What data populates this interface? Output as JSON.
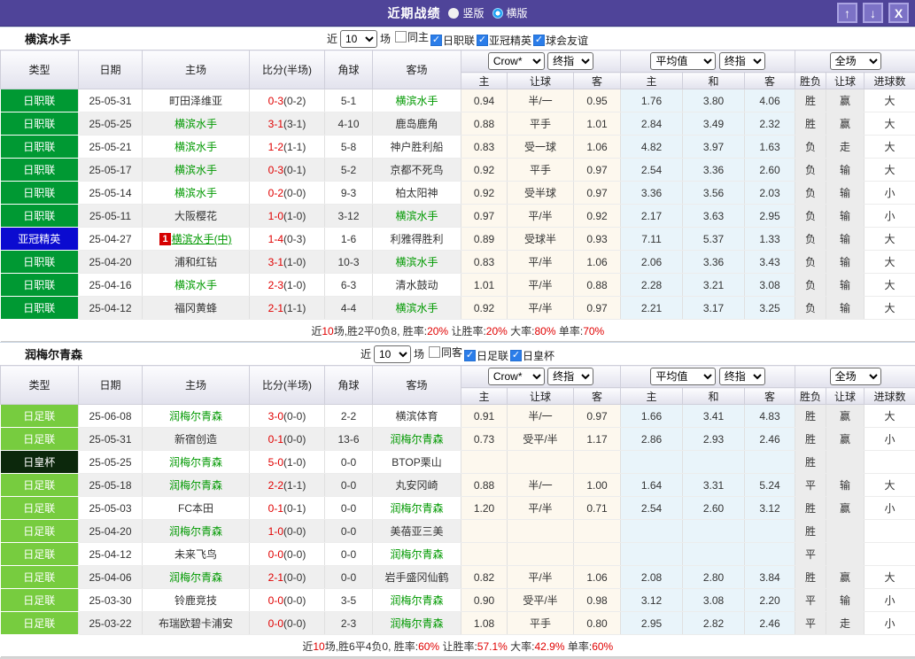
{
  "colors": {
    "titlebar_purple": "#4f4499",
    "button_purple": "#7c72c6",
    "checkbox_blue": "#2b7de9",
    "radio_selected_blue": "#1fa2f3",
    "jleague_green": "#009933",
    "acl_blue": "#0b0bd0",
    "jfl_light_green": "#77cc3f",
    "emperor_cup_dark": "#0c280c",
    "score_red": "#e00000",
    "self_team_green": "#009900",
    "lose_blue": "#2626cc",
    "crown_odds_bg": "#fdf8ee",
    "euro_odds_bg": "#e9f4fa",
    "result_col_bg": "#ececec"
  },
  "titlebar": {
    "title": "近期战绩",
    "radios": [
      {
        "label": "竖版",
        "selected": false
      },
      {
        "label": "横版",
        "selected": true
      }
    ],
    "up_icon": "↑",
    "down_icon": "↓",
    "close_icon": "X"
  },
  "filter_shared": {
    "near": "近",
    "games": "场"
  },
  "columns": {
    "type": "类型",
    "date": "日期",
    "home": "主场",
    "score": "比分(半场)",
    "corner": "角球",
    "away": "客场",
    "ah_home": "主",
    "ah_line": "让球",
    "ah_away": "客",
    "eu_home": "主",
    "eu_draw": "和",
    "eu_away": "客",
    "result": "胜负",
    "handicap_result": "让球",
    "goals": "进球数"
  },
  "sections": [
    {
      "team": "横滨水手",
      "selects": {
        "count": "10",
        "crown": "Crow*",
        "crown_final": "终指",
        "avg": "平均值",
        "avg_final": "终指",
        "full": "全场"
      },
      "filters": [
        {
          "label": "同主",
          "checked": false
        },
        {
          "label": "日职联",
          "checked": true
        },
        {
          "label": "亚冠精英",
          "checked": true
        },
        {
          "label": "球会友谊",
          "checked": true
        }
      ],
      "rows": [
        {
          "league": "日职联",
          "league_class": "jleague",
          "date": "25-05-31",
          "home": "町田泽维亚",
          "home_self": false,
          "score": "0-3",
          "half": "(0-2)",
          "corner": "5-1",
          "away": "横滨水手",
          "away_self": true,
          "ah": [
            "0.94",
            "半/一",
            "0.95"
          ],
          "eu": [
            "1.76",
            "3.80",
            "4.06"
          ],
          "res": [
            "胜",
            "赢",
            "大"
          ]
        },
        {
          "league": "日职联",
          "league_class": "jleague",
          "date": "25-05-25",
          "home": "横滨水手",
          "home_self": true,
          "score": "3-1",
          "half": "(3-1)",
          "corner": "4-10",
          "away": "鹿岛鹿角",
          "away_self": false,
          "ah": [
            "0.88",
            "平手",
            "1.01"
          ],
          "eu": [
            "2.84",
            "3.49",
            "2.32"
          ],
          "res": [
            "胜",
            "赢",
            "大"
          ]
        },
        {
          "league": "日职联",
          "league_class": "jleague",
          "date": "25-05-21",
          "home": "横滨水手",
          "home_self": true,
          "score": "1-2",
          "half": "(1-1)",
          "corner": "5-8",
          "away": "神户胜利船",
          "away_self": false,
          "ah": [
            "0.83",
            "受一球",
            "1.06"
          ],
          "eu": [
            "4.82",
            "3.97",
            "1.63"
          ],
          "res": [
            "负",
            "走",
            "大"
          ]
        },
        {
          "league": "日职联",
          "league_class": "jleague",
          "date": "25-05-17",
          "home": "横滨水手",
          "home_self": true,
          "score": "0-3",
          "half": "(0-1)",
          "corner": "5-2",
          "away": "京都不死鸟",
          "away_self": false,
          "ah": [
            "0.92",
            "平手",
            "0.97"
          ],
          "eu": [
            "2.54",
            "3.36",
            "2.60"
          ],
          "res": [
            "负",
            "输",
            "大"
          ]
        },
        {
          "league": "日职联",
          "league_class": "jleague",
          "date": "25-05-14",
          "home": "横滨水手",
          "home_self": true,
          "score": "0-2",
          "half": "(0-0)",
          "corner": "9-3",
          "away": "柏太阳神",
          "away_self": false,
          "ah": [
            "0.92",
            "受半球",
            "0.97"
          ],
          "eu": [
            "3.36",
            "3.56",
            "2.03"
          ],
          "res": [
            "负",
            "输",
            "小"
          ]
        },
        {
          "league": "日职联",
          "league_class": "jleague",
          "date": "25-05-11",
          "home": "大阪樱花",
          "home_self": false,
          "score": "1-0",
          "half": "(1-0)",
          "corner": "3-12",
          "away": "横滨水手",
          "away_self": true,
          "ah": [
            "0.97",
            "平/半",
            "0.92"
          ],
          "eu": [
            "2.17",
            "3.63",
            "2.95"
          ],
          "res": [
            "负",
            "输",
            "小"
          ]
        },
        {
          "league": "亚冠精英",
          "league_class": "acl",
          "date": "25-04-27",
          "home": "横滨水手(中)",
          "home_self": true,
          "home_underline": true,
          "badge": "1",
          "score": "1-4",
          "half": "(0-3)",
          "corner": "1-6",
          "away": "利雅得胜利",
          "away_self": false,
          "ah": [
            "0.89",
            "受球半",
            "0.93"
          ],
          "eu": [
            "7.11",
            "5.37",
            "1.33"
          ],
          "res": [
            "负",
            "输",
            "大"
          ]
        },
        {
          "league": "日职联",
          "league_class": "jleague",
          "date": "25-04-20",
          "home": "浦和红钻",
          "home_self": false,
          "score": "3-1",
          "half": "(1-0)",
          "corner": "10-3",
          "away": "横滨水手",
          "away_self": true,
          "ah": [
            "0.83",
            "平/半",
            "1.06"
          ],
          "eu": [
            "2.06",
            "3.36",
            "3.43"
          ],
          "res": [
            "负",
            "输",
            "大"
          ]
        },
        {
          "league": "日职联",
          "league_class": "jleague",
          "date": "25-04-16",
          "home": "横滨水手",
          "home_self": true,
          "score": "2-3",
          "half": "(1-0)",
          "corner": "6-3",
          "away": "清水鼓动",
          "away_self": false,
          "ah": [
            "1.01",
            "平/半",
            "0.88"
          ],
          "eu": [
            "2.28",
            "3.21",
            "3.08"
          ],
          "res": [
            "负",
            "输",
            "大"
          ]
        },
        {
          "league": "日职联",
          "league_class": "jleague",
          "date": "25-04-12",
          "home": "福冈黄蜂",
          "home_self": false,
          "score": "2-1",
          "half": "(1-1)",
          "corner": "4-4",
          "away": "横滨水手",
          "away_self": true,
          "ah": [
            "0.92",
            "平/半",
            "0.97"
          ],
          "eu": [
            "2.21",
            "3.17",
            "3.25"
          ],
          "res": [
            "负",
            "输",
            "大"
          ]
        }
      ],
      "summary": [
        {
          "text": "近",
          "red": false
        },
        {
          "text": "10",
          "red": true
        },
        {
          "text": "场,胜2平0负8, 胜率:",
          "red": false
        },
        {
          "text": "20%",
          "red": true
        },
        {
          "text": " 让胜率:",
          "red": false
        },
        {
          "text": "20%",
          "red": true
        },
        {
          "text": " 大率:",
          "red": false
        },
        {
          "text": "80%",
          "red": true
        },
        {
          "text": " 单率:",
          "red": false
        },
        {
          "text": "70%",
          "red": true
        }
      ]
    },
    {
      "team": "润梅尔青森",
      "selects": {
        "count": "10",
        "crown": "Crow*",
        "crown_final": "终指",
        "avg": "平均值",
        "avg_final": "终指",
        "full": "全场"
      },
      "filters": [
        {
          "label": "同客",
          "checked": false
        },
        {
          "label": "日足联",
          "checked": true
        },
        {
          "label": "日皇杯",
          "checked": true
        }
      ],
      "rows": [
        {
          "league": "日足联",
          "league_class": "jfl",
          "date": "25-06-08",
          "home": "润梅尔青森",
          "home_self": true,
          "score": "3-0",
          "half": "(0-0)",
          "corner": "2-2",
          "away": "横滨体育",
          "away_self": false,
          "ah": [
            "0.91",
            "半/一",
            "0.97"
          ],
          "eu": [
            "1.66",
            "3.41",
            "4.83"
          ],
          "res": [
            "胜",
            "赢",
            "大"
          ]
        },
        {
          "league": "日足联",
          "league_class": "jfl",
          "date": "25-05-31",
          "home": "新宿创造",
          "home_self": false,
          "score": "0-1",
          "half": "(0-0)",
          "corner": "13-6",
          "away": "润梅尔青森",
          "away_self": true,
          "ah": [
            "0.73",
            "受平/半",
            "1.17"
          ],
          "eu": [
            "2.86",
            "2.93",
            "2.46"
          ],
          "res": [
            "胜",
            "赢",
            "小"
          ]
        },
        {
          "league": "日皇杯",
          "league_class": "emperor",
          "date": "25-05-25",
          "home": "润梅尔青森",
          "home_self": true,
          "score": "5-0",
          "half": "(1-0)",
          "corner": "0-0",
          "away": "BTOP栗山",
          "away_self": false,
          "ah": [
            "",
            "",
            ""
          ],
          "eu": [
            "",
            "",
            ""
          ],
          "res": [
            "胜",
            "",
            ""
          ]
        },
        {
          "league": "日足联",
          "league_class": "jfl",
          "date": "25-05-18",
          "home": "润梅尔青森",
          "home_self": true,
          "score": "2-2",
          "half": "(1-1)",
          "corner": "0-0",
          "away": "丸安冈崎",
          "away_self": false,
          "ah": [
            "0.88",
            "半/一",
            "1.00"
          ],
          "eu": [
            "1.64",
            "3.31",
            "5.24"
          ],
          "res": [
            "平",
            "输",
            "大"
          ]
        },
        {
          "league": "日足联",
          "league_class": "jfl",
          "date": "25-05-03",
          "home": "FC本田",
          "home_self": false,
          "score": "0-1",
          "half": "(0-1)",
          "corner": "0-0",
          "away": "润梅尔青森",
          "away_self": true,
          "ah": [
            "1.20",
            "平/半",
            "0.71"
          ],
          "eu": [
            "2.54",
            "2.60",
            "3.12"
          ],
          "res": [
            "胜",
            "赢",
            "小"
          ]
        },
        {
          "league": "日足联",
          "league_class": "jfl",
          "date": "25-04-20",
          "home": "润梅尔青森",
          "home_self": true,
          "score": "1-0",
          "half": "(0-0)",
          "corner": "0-0",
          "away": "美蓓亚三美",
          "away_self": false,
          "ah": [
            "",
            "",
            ""
          ],
          "eu": [
            "",
            "",
            ""
          ],
          "res": [
            "胜",
            "",
            ""
          ]
        },
        {
          "league": "日足联",
          "league_class": "jfl",
          "date": "25-04-12",
          "home": "未来飞鸟",
          "home_self": false,
          "score": "0-0",
          "half": "(0-0)",
          "corner": "0-0",
          "away": "润梅尔青森",
          "away_self": true,
          "ah": [
            "",
            "",
            ""
          ],
          "eu": [
            "",
            "",
            ""
          ],
          "res": [
            "平",
            "",
            ""
          ]
        },
        {
          "league": "日足联",
          "league_class": "jfl",
          "date": "25-04-06",
          "home": "润梅尔青森",
          "home_self": true,
          "score": "2-1",
          "half": "(0-0)",
          "corner": "0-0",
          "away": "岩手盛冈仙鹤",
          "away_self": false,
          "ah": [
            "0.82",
            "平/半",
            "1.06"
          ],
          "eu": [
            "2.08",
            "2.80",
            "3.84"
          ],
          "res": [
            "胜",
            "赢",
            "大"
          ]
        },
        {
          "league": "日足联",
          "league_class": "jfl",
          "date": "25-03-30",
          "home": "铃鹿竞技",
          "home_self": false,
          "score": "0-0",
          "half": "(0-0)",
          "corner": "3-5",
          "away": "润梅尔青森",
          "away_self": true,
          "ah": [
            "0.90",
            "受平/半",
            "0.98"
          ],
          "eu": [
            "3.12",
            "3.08",
            "2.20"
          ],
          "res": [
            "平",
            "输",
            "小"
          ]
        },
        {
          "league": "日足联",
          "league_class": "jfl",
          "date": "25-03-22",
          "home": "布瑞欧碧卡浦安",
          "home_self": false,
          "score": "0-0",
          "half": "(0-0)",
          "corner": "2-3",
          "away": "润梅尔青森",
          "away_self": true,
          "ah": [
            "1.08",
            "平手",
            "0.80"
          ],
          "eu": [
            "2.95",
            "2.82",
            "2.46"
          ],
          "res": [
            "平",
            "走",
            "小"
          ]
        }
      ],
      "summary": [
        {
          "text": "近",
          "red": false
        },
        {
          "text": "10",
          "red": true
        },
        {
          "text": "场,胜6平4负0, 胜率:",
          "red": false
        },
        {
          "text": "60%",
          "red": true
        },
        {
          "text": " 让胜率:",
          "red": false
        },
        {
          "text": "57.1%",
          "red": true
        },
        {
          "text": " 大率:",
          "red": false
        },
        {
          "text": "42.9%",
          "red": true
        },
        {
          "text": " 单率:",
          "red": false
        },
        {
          "text": "60%",
          "red": true
        }
      ]
    }
  ]
}
